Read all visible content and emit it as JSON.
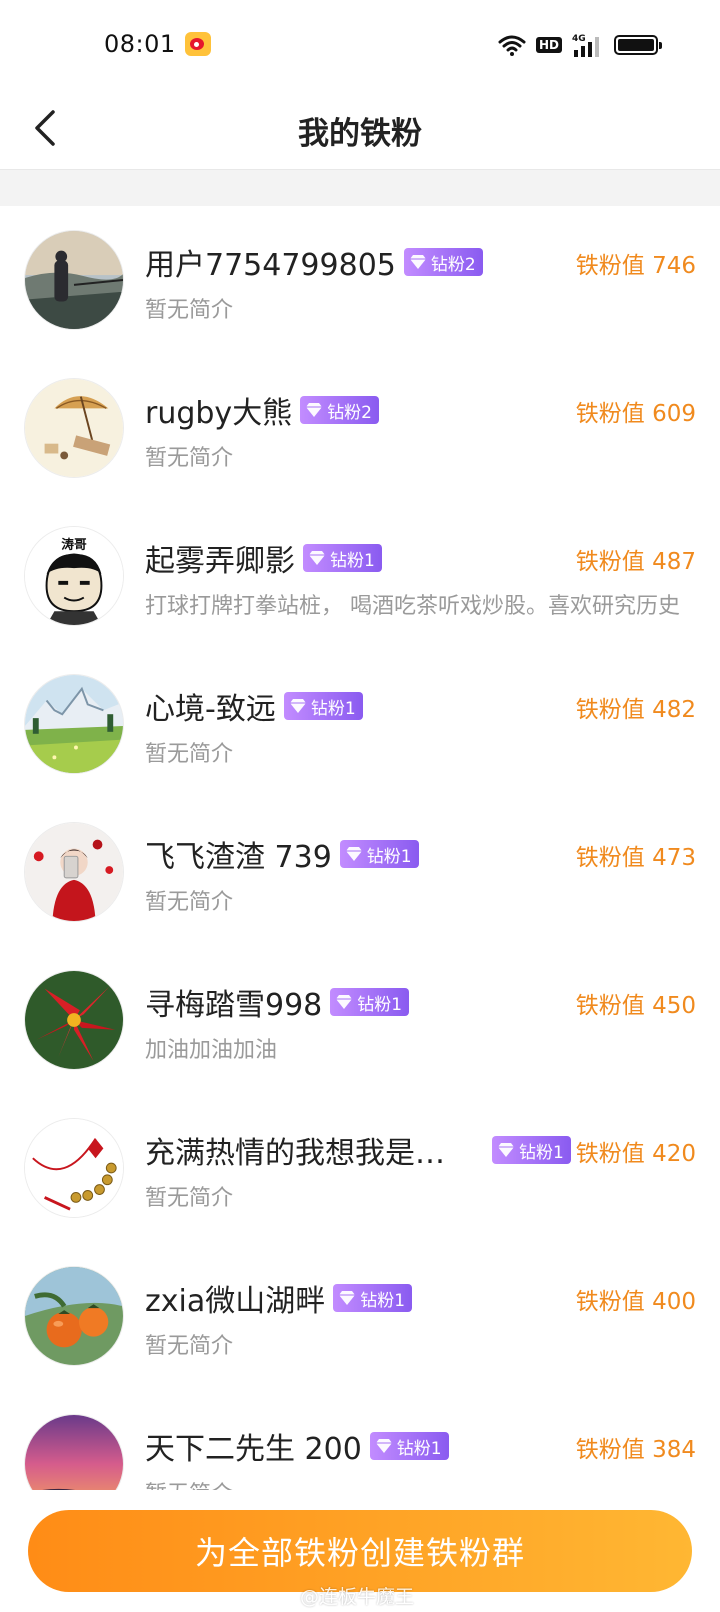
{
  "status_bar": {
    "time": "08:01",
    "hd_label": "HD",
    "network_label": "4G"
  },
  "header": {
    "title": "我的铁粉",
    "back_icon": "chevron-left-icon"
  },
  "fans": [
    {
      "name": "用户7754799805",
      "badge": "钻粉2",
      "bio": "暂无简介",
      "score": "铁粉值 746",
      "avatar": "mountain-person-photo"
    },
    {
      "name": "rugby大熊",
      "badge": "钻粉2",
      "bio": "暂无简介",
      "score": "铁粉值 609",
      "avatar": "beach-umbrella-drawing"
    },
    {
      "name": "起雾弄卿影",
      "badge": "钻粉1",
      "bio": "打球打牌打拳站桩， 喝酒吃茶听戏炒股。喜欢研究历史",
      "score": "铁粉值 487",
      "avatar": "cartoon-face-sticker",
      "avatar_caption": "涛哥"
    },
    {
      "name": "心境-致远",
      "badge": "钻粉1",
      "bio": "暂无简介",
      "score": "铁粉值 482",
      "avatar": "alpine-meadow-painting"
    },
    {
      "name": "飞飞渣渣 739",
      "badge": "钻粉1",
      "bio": "暂无简介",
      "score": "铁粉值 473",
      "avatar": "red-dress-selfie"
    },
    {
      "name": "寻梅踏雪998",
      "badge": "钻粉1",
      "bio": "加油加油加油",
      "score": "铁粉值 450",
      "avatar": "red-flower-photo"
    },
    {
      "name": "充满热情的我想我是你的唯一",
      "badge": "钻粉1",
      "bio": "暂无简介",
      "score": "铁粉值 420",
      "avatar": "chinese-knot-coins"
    },
    {
      "name": "zxia微山湖畔",
      "badge": "钻粉1",
      "bio": "暂无简介",
      "score": "铁粉值 400",
      "avatar": "persimmon-photo"
    },
    {
      "name": "天下二先生 200",
      "badge": "钻粉1",
      "bio": "暂无简介",
      "score": "铁粉值 384",
      "avatar": "sunset-sky-photo"
    }
  ],
  "footer": {
    "create_button": "为全部铁粉创建铁粉群",
    "watermark": "@连板牛魔王"
  },
  "colors": {
    "accent_orange": "#f08a1e",
    "button_gradient_start": "#ff8c16",
    "button_gradient_end": "#ffb733",
    "badge_purple": "#8a5bf0"
  }
}
